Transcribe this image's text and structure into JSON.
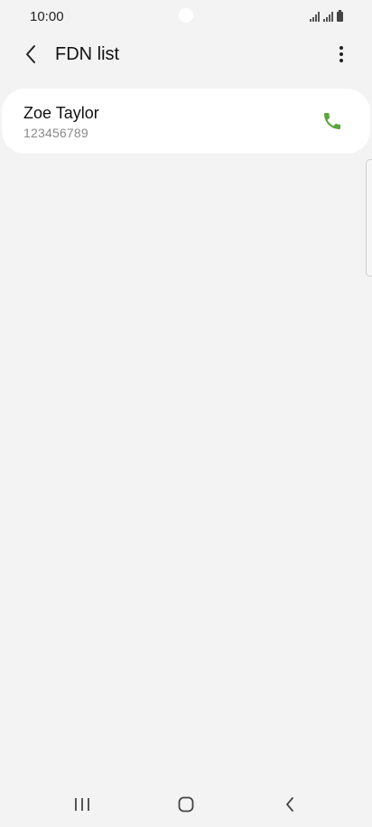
{
  "status_bar": {
    "time": "10:00"
  },
  "app_bar": {
    "title": "FDN list",
    "back_icon": "chevron-left-icon",
    "more_icon": "more-vertical-icon"
  },
  "contacts": [
    {
      "name": "Zoe Taylor",
      "number": "123456789",
      "call_icon": "phone-icon"
    }
  ],
  "nav_bar": {
    "recents_icon": "recents-icon",
    "home_icon": "home-icon",
    "back_icon": "back-icon"
  },
  "colors": {
    "background": "#f3f3f3",
    "card": "#ffffff",
    "call_green": "#5aa53c",
    "text_primary": "#111111",
    "text_secondary": "#8a8a8a"
  }
}
